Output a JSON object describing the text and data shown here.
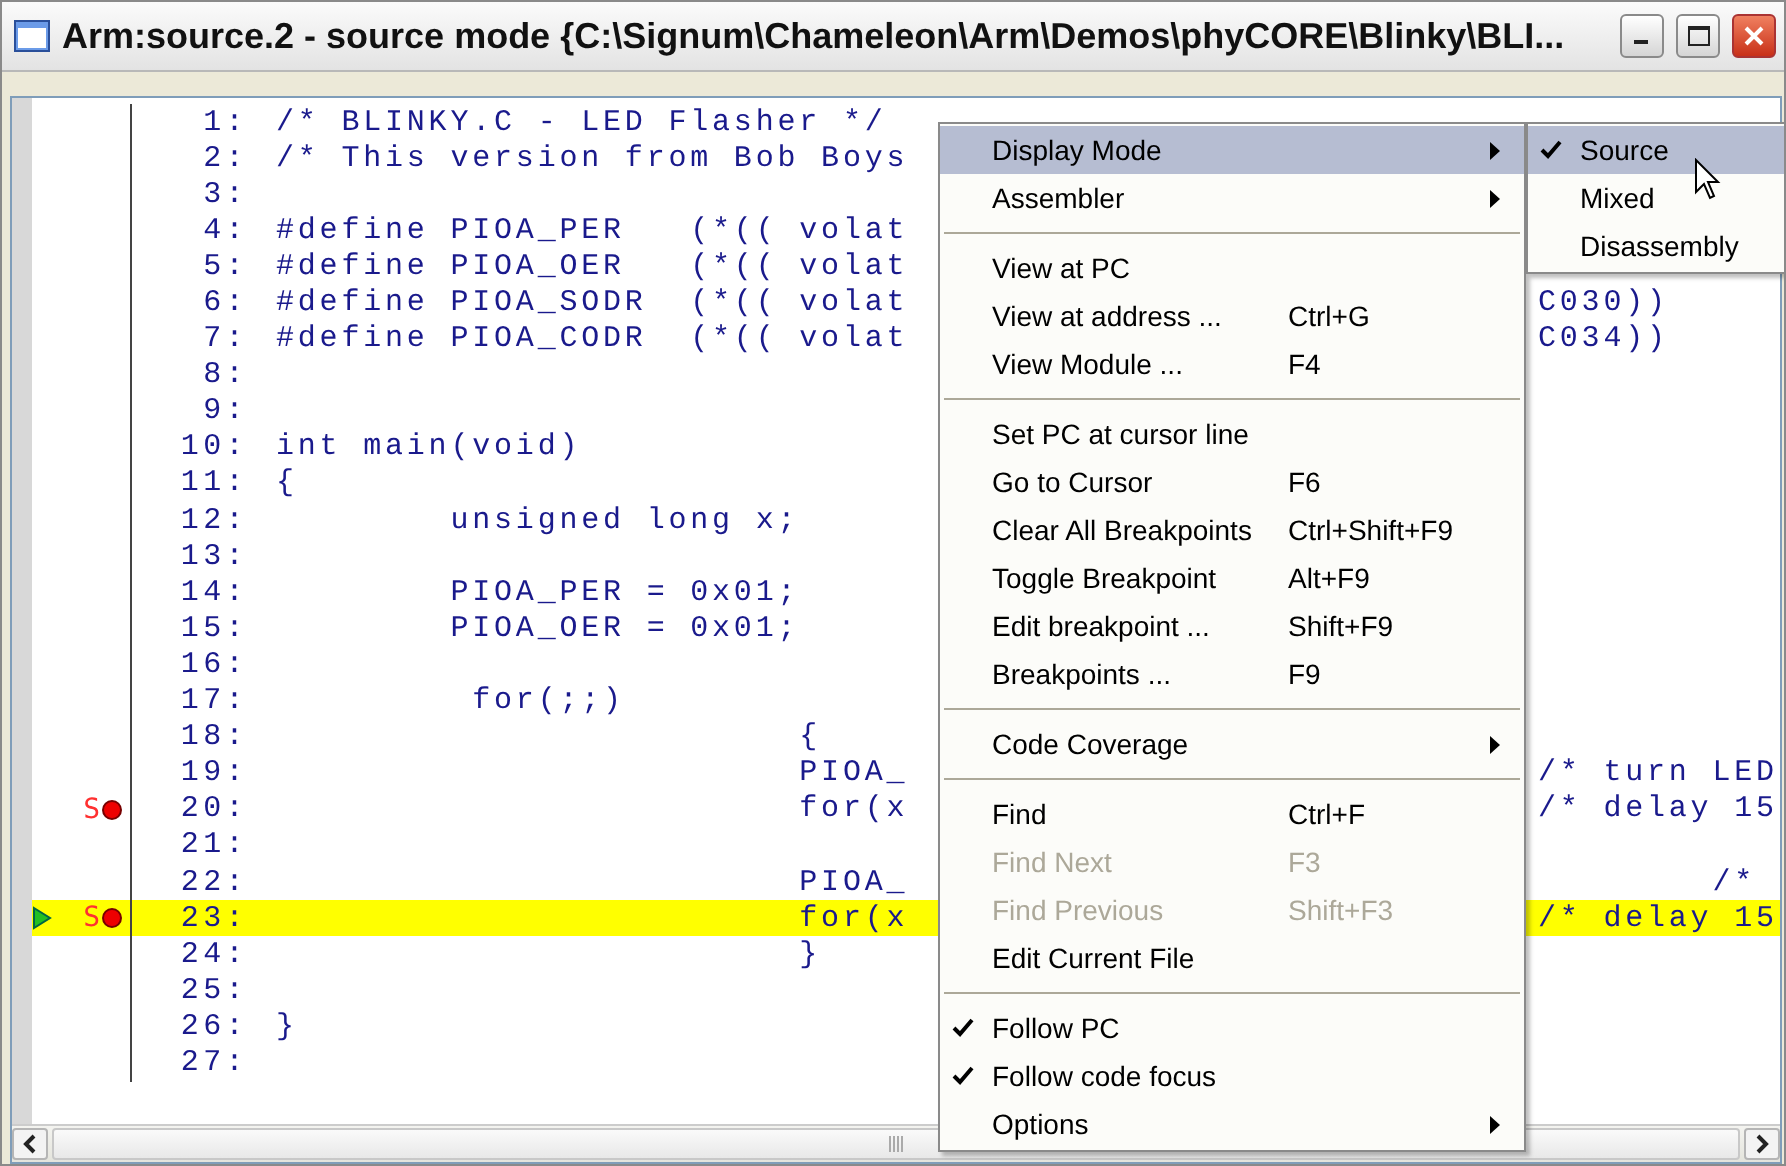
{
  "window": {
    "title": "Arm:source.2 - source mode {C:\\Signum\\Chameleon\\Arm\\Demos\\phyCORE\\Blinky\\BLI..."
  },
  "code_lines": [
    {
      "number": "1:",
      "text": "/* BLINKY.C - LED Flasher */"
    },
    {
      "number": "2:",
      "text": "/* This version from Bob Boys"
    },
    {
      "number": "3:"
    },
    {
      "number": "4:",
      "text": "#define PIOA_PER   (*(( volat"
    },
    {
      "number": "5:",
      "text": "#define PIOA_OER   (*(( volat"
    },
    {
      "number": "6:",
      "text": "#define PIOA_SODR  (*(( volat",
      "tail": "C030))"
    },
    {
      "number": "7:",
      "text": "#define PIOA_CODR  (*(( volat",
      "tail": "C034))"
    },
    {
      "number": "8:"
    },
    {
      "number": "9:"
    },
    {
      "number": "10:",
      "text": "int main(void)"
    },
    {
      "number": "11:",
      "text": "{"
    },
    {
      "number": "12:",
      "text": "        unsigned long x;"
    },
    {
      "number": "13:"
    },
    {
      "number": "14:",
      "text": "        PIOA_PER = 0x01;"
    },
    {
      "number": "15:",
      "text": "        PIOA_OER = 0x01;"
    },
    {
      "number": "16:"
    },
    {
      "number": "17:",
      "text": "         for(;;)"
    },
    {
      "number": "18:",
      "text": "                        {"
    },
    {
      "number": "19:",
      "text": "                        PIOA_",
      "tail": "/* turn LED"
    },
    {
      "number": "20:",
      "text": "                        for(x",
      "tail": "/* delay 15",
      "marker": "S",
      "breakpoint": true
    },
    {
      "number": "21:"
    },
    {
      "number": "22:",
      "text": "                        PIOA_",
      "tail": "        /*"
    },
    {
      "number": "23:",
      "text": "                        for(x",
      "tail": "/* delay 15",
      "marker": "S",
      "breakpoint": true,
      "current": true
    },
    {
      "number": "24:",
      "text": "                        }"
    },
    {
      "number": "25:"
    },
    {
      "number": "26:",
      "text": "}"
    },
    {
      "number": "27:"
    }
  ],
  "context_menu": [
    {
      "kind": "item",
      "label": "Display Mode",
      "submenu": true,
      "selected": true
    },
    {
      "kind": "item",
      "label": "Assembler",
      "submenu": true,
      "selected": false
    },
    {
      "kind": "separator"
    },
    {
      "kind": "item",
      "label": "View at PC",
      "selected": false
    },
    {
      "kind": "item",
      "label": "View at address ...",
      "shortcut": "Ctrl+G",
      "selected": false
    },
    {
      "kind": "item",
      "label": "View Module ...",
      "shortcut": "F4",
      "selected": false
    },
    {
      "kind": "separator"
    },
    {
      "kind": "item",
      "label": "Set PC at cursor line",
      "selected": false
    },
    {
      "kind": "item",
      "label": "Go to Cursor",
      "shortcut": "F6",
      "selected": false
    },
    {
      "kind": "item",
      "label": "Clear All Breakpoints",
      "shortcut": "Ctrl+Shift+F9",
      "selected": false
    },
    {
      "kind": "item",
      "label": "Toggle Breakpoint",
      "shortcut": "Alt+F9",
      "selected": false
    },
    {
      "kind": "item",
      "label": "Edit breakpoint ...",
      "shortcut": "Shift+F9",
      "selected": false
    },
    {
      "kind": "item",
      "label": "Breakpoints ...",
      "shortcut": "F9",
      "selected": false
    },
    {
      "kind": "separator"
    },
    {
      "kind": "item",
      "label": "Code Coverage",
      "submenu": true,
      "selected": false
    },
    {
      "kind": "separator"
    },
    {
      "kind": "item",
      "label": "Find",
      "shortcut": "Ctrl+F",
      "selected": false
    },
    {
      "kind": "item",
      "label": "Find Next",
      "shortcut": "F3",
      "disabled": true,
      "selected": false
    },
    {
      "kind": "item",
      "label": "Find Previous",
      "shortcut": "Shift+F3",
      "disabled": true,
      "selected": false
    },
    {
      "kind": "item",
      "label": "Edit Current File",
      "selected": false
    },
    {
      "kind": "separator"
    },
    {
      "kind": "item",
      "label": "Follow PC",
      "checked": true,
      "selected": false
    },
    {
      "kind": "item",
      "label": "Follow code focus",
      "checked": true,
      "selected": false
    },
    {
      "kind": "item",
      "label": "Options",
      "submenu": true,
      "selected": false
    }
  ],
  "display_mode_submenu": [
    {
      "label": "Source",
      "checked": true,
      "selected": true
    },
    {
      "label": "Mixed",
      "checked": false,
      "selected": false
    },
    {
      "label": "Disassembly",
      "checked": false,
      "selected": false
    }
  ]
}
